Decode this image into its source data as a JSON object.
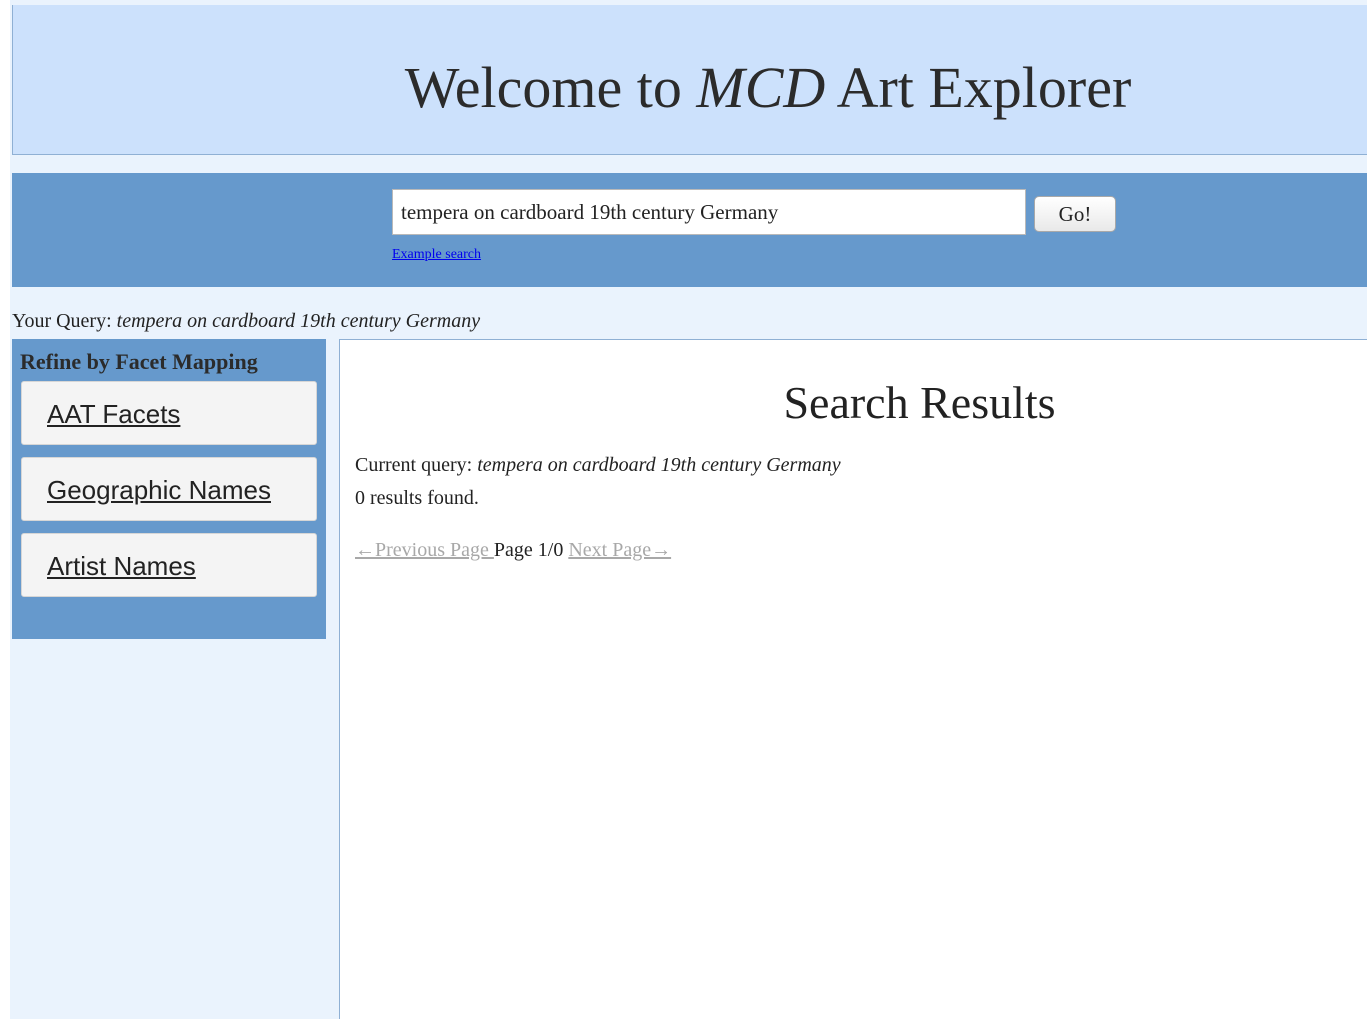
{
  "header": {
    "title_prefix": "Welcome to ",
    "title_brand": "MCD",
    "title_suffix": " Art Explorer"
  },
  "search": {
    "value": "tempera on cardboard 19th century Germany",
    "go_label": "Go!",
    "example_link": "Example search"
  },
  "your_query": {
    "label": "Your Query: ",
    "value": "tempera on cardboard 19th century Germany"
  },
  "sidebar": {
    "title": "Refine by Facet Mapping",
    "facets": [
      {
        "label": "AAT Facets"
      },
      {
        "label": "Geographic Names"
      },
      {
        "label": "Artist Names"
      }
    ]
  },
  "results": {
    "title": "Search Results",
    "current_query_label": "Current query: ",
    "current_query_value": "tempera on cardboard 19th century Germany",
    "count_text": "0 results found.",
    "pager": {
      "previous": "←Previous Page ",
      "page_info": " Page 1/0 ",
      "next": "Next Page→"
    }
  },
  "colors": {
    "header_bg": "#cce1fc",
    "bar_bg": "#6699cc",
    "page_bg": "#eaf3fd",
    "link": "#0000ee",
    "disabled_link": "#a8a8a8"
  }
}
